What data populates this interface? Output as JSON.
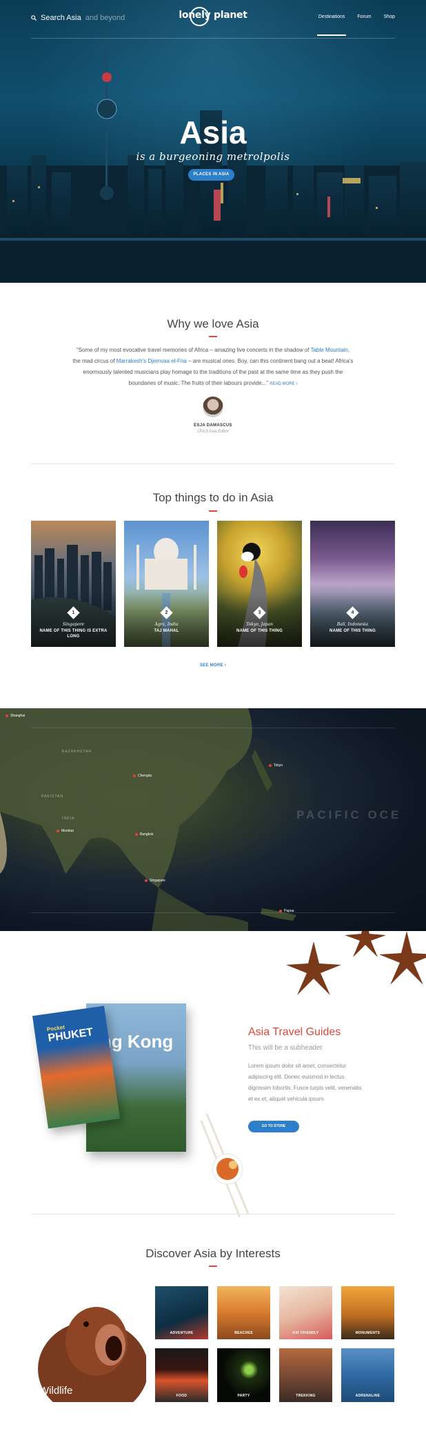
{
  "header": {
    "search_label": "Search Asia",
    "search_suffix": "and beyond",
    "logo": "lonely planet",
    "nav": [
      "Destinations",
      "Forum",
      "Shop"
    ]
  },
  "hero": {
    "title": "Asia",
    "subtitle": "is a burgeoning metrolpolis",
    "button": "PLACES IN ASIA"
  },
  "why": {
    "title": "Why we love Asia",
    "quote_parts": [
      "\"Some of my most evocative travel memories of Africa – amazing live concerts in the shadow of ",
      "Table Mountain",
      ",",
      "the mad circus of ",
      "Marrakesh's Djemvaa el-Fna",
      " – are musical ones. Boy, can this continent bang out a beat! Africa's",
      "enormously talented musicians play homage to the traditions of the past at the same time  as they push the",
      "boundaries of music. The fruits of their labours provide...\"",
      "READ MORE ›"
    ],
    "author": "ESJA DAMASCUS",
    "author_role": "LP/Lit Asia Editor"
  },
  "top_things": {
    "title": "Top things to do in Asia",
    "cards": [
      {
        "num": "1",
        "place": "Singapore",
        "name": "NAME OF THIS THING IS EXTRA LONG"
      },
      {
        "num": "2",
        "place": "Agra, India",
        "name": "TAJ MAHAL"
      },
      {
        "num": "3",
        "place": "Tokyo, Japan",
        "name": "NAME OF THIS THING"
      },
      {
        "num": "4",
        "place": "Bali, Indonesia",
        "name": "NAME OF THIS THING"
      }
    ],
    "see_more": "SEE MORE ›"
  },
  "map": {
    "pins": [
      "Shanghai",
      "Chengdu",
      "Tokyo",
      "Mumbai",
      "Bangkok",
      "Singapore",
      "Papua"
    ],
    "regions": [
      "KAZAKHSTAN",
      "PAKISTAN",
      "INDIA"
    ],
    "ocean": "PACIFIC OCE"
  },
  "guides": {
    "title": "Asia Travel Guides",
    "subtitle": "This will be a subheader",
    "body": "Lorem ipsum dolor sit amet, consectetur adipiscing elit. Donec euismod in lectus dignissim lobortis. Fusce turpis velit, venenatis et ex et, aliquet vehicula ipsum.",
    "button": "GO TO STORE",
    "book_front_title": "PHUKET",
    "book_front_prefix": "Pocket",
    "book_back_title": "ong Kong"
  },
  "interests": {
    "title": "Discover Asia by Interests",
    "feature": "Wildlife",
    "tiles": [
      "ADVENTURE",
      "BEACHES",
      "KID FRIENDLY",
      "MONUMENTS",
      "FOOD",
      "PARTY",
      "TREKKING",
      "ADRENALINE"
    ]
  },
  "colors": {
    "accent": "#e0463a",
    "link": "#2d7fc9"
  }
}
